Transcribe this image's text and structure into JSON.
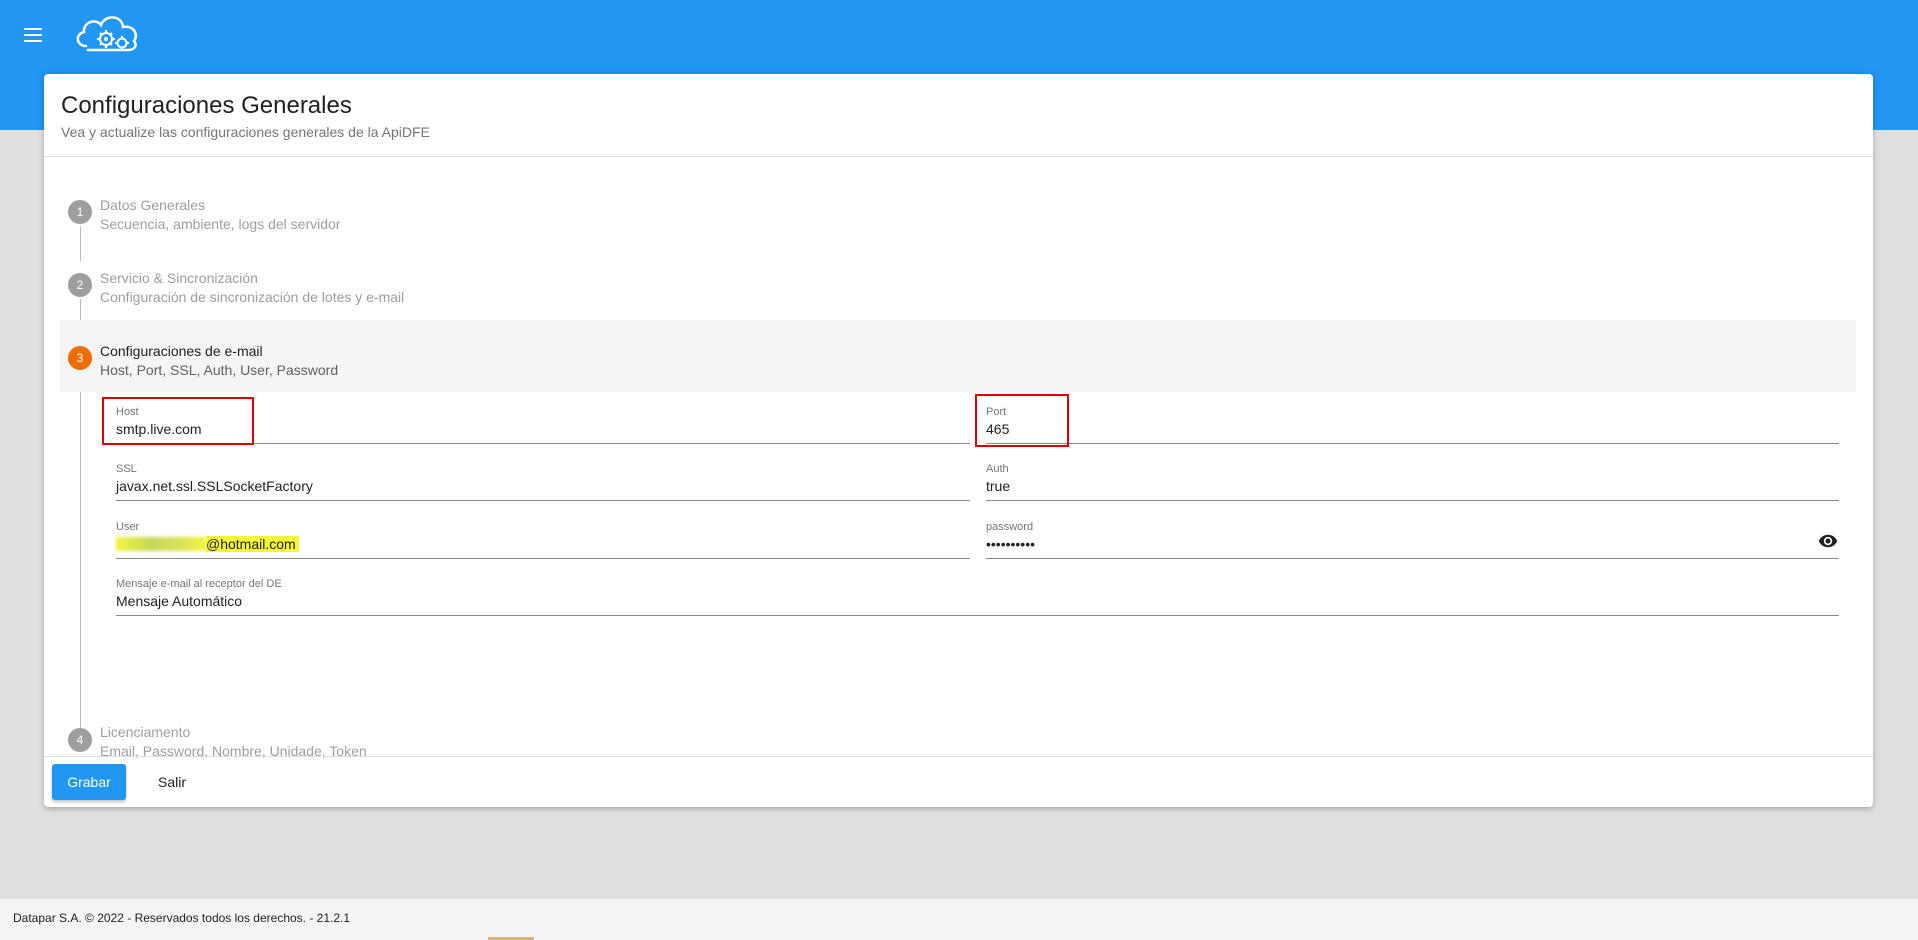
{
  "header": {
    "menu_icon": "hamburger-menu-icon",
    "logo_icon": "cloud-gears-icon",
    "bar_color": "#2196f3"
  },
  "card": {
    "title": "Configuraciones Generales",
    "subtitle": "Vea y actualize las configuraciones generales de la ApiDFE"
  },
  "steps": [
    {
      "number": "1",
      "title": "Datos Generales",
      "subtitle": "Secuencia, ambiente, logs del servidor",
      "active": false
    },
    {
      "number": "2",
      "title": "Servicio & Sincronización",
      "subtitle": "Configuración de sincronización de lotes y e-mail",
      "active": false
    },
    {
      "number": "3",
      "title": "Configuraciones de e-mail",
      "subtitle": "Host, Port, SSL, Auth, User, Password",
      "active": true
    },
    {
      "number": "4",
      "title": "Licenciamento",
      "subtitle": "Email, Password, Nombre, Unidade, Token",
      "active": false
    }
  ],
  "email_form": {
    "host": {
      "label": "Host",
      "value": "smtp.live.com"
    },
    "port": {
      "label": "Port",
      "value": "465"
    },
    "ssl": {
      "label": "SSL",
      "value": "javax.net.ssl.SSLSocketFactory"
    },
    "auth": {
      "label": "Auth",
      "value": "true"
    },
    "user": {
      "label": "User",
      "value_visible": "@hotmail.com"
    },
    "password": {
      "label": "password",
      "value": "••••••••••",
      "toggle_icon": "eye-icon"
    },
    "mensaje": {
      "label": "Mensaje e-mail al receptor del DE",
      "value": "Mensaje Automático"
    }
  },
  "actions": {
    "save_label": "Grabar",
    "exit_label": "Salir"
  },
  "footer": {
    "text": "Datapar S.A. © 2022 - Reservados todos los derechos. - 21.2.1"
  },
  "colors": {
    "primary": "#2196f3",
    "active_step": "#ef6c00",
    "inactive_step": "#9e9e9e",
    "annotation_red": "#e00000",
    "highlight_yellow": "#f6f63a"
  }
}
